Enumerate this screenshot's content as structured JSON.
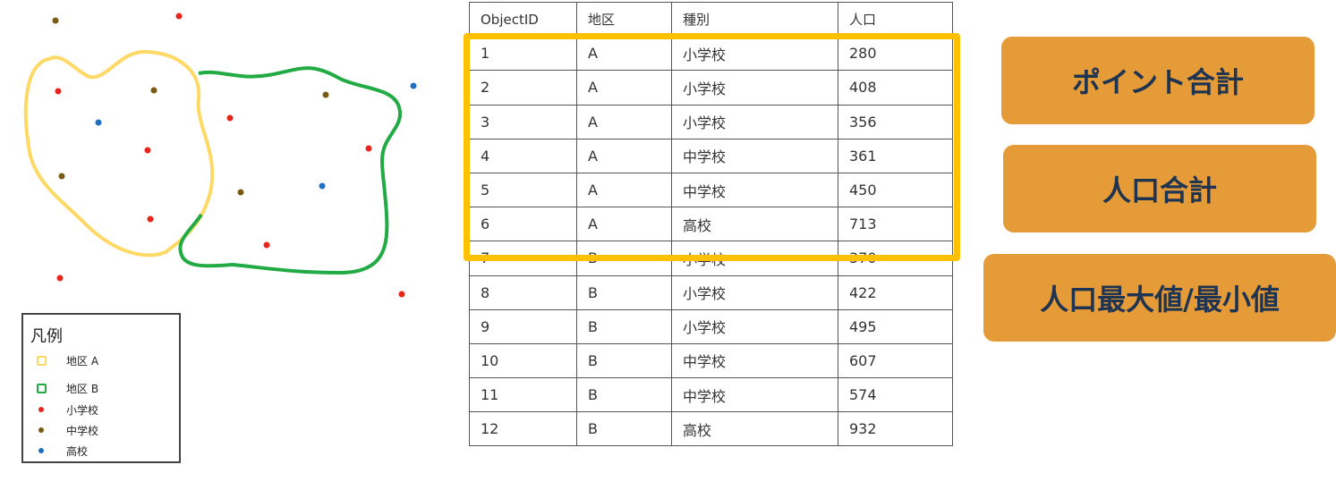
{
  "legend": {
    "title": "凡例",
    "items": [
      {
        "label": "地区 A",
        "kind": "square",
        "color": "#ffd966"
      },
      {
        "label": "地区 B",
        "kind": "square",
        "color": "#22aa44"
      },
      {
        "label": "小学校",
        "kind": "dot",
        "color": "#e8241c"
      },
      {
        "label": "中学校",
        "kind": "dot",
        "color": "#7a5a12"
      },
      {
        "label": "高校",
        "kind": "dot",
        "color": "#1f6fc2"
      }
    ]
  },
  "table": {
    "headers": [
      "ObjectID",
      "地区",
      "種別",
      "人口"
    ],
    "rows": [
      [
        "1",
        "A",
        "小学校",
        "280"
      ],
      [
        "2",
        "A",
        "小学校",
        "408"
      ],
      [
        "3",
        "A",
        "小学校",
        "356"
      ],
      [
        "4",
        "A",
        "中学校",
        "361"
      ],
      [
        "5",
        "A",
        "中学校",
        "450"
      ],
      [
        "6",
        "A",
        "高校",
        "713"
      ],
      [
        "7",
        "B",
        "小学校",
        "370"
      ],
      [
        "8",
        "B",
        "小学校",
        "422"
      ],
      [
        "9",
        "B",
        "小学校",
        "495"
      ],
      [
        "10",
        "B",
        "中学校",
        "607"
      ],
      [
        "11",
        "B",
        "中学校",
        "574"
      ],
      [
        "12",
        "B",
        "高校",
        "932"
      ]
    ]
  },
  "buttons": {
    "point_total": "ポイント合計",
    "population_total": "人口合計",
    "population_maxmin": "人口最大値/最小値"
  },
  "colors": {
    "area_a": "#ffd966",
    "area_b": "#22aa44",
    "highlight": "#ffc000",
    "button_bg": "#e59b38",
    "button_text": "#1f3451"
  }
}
